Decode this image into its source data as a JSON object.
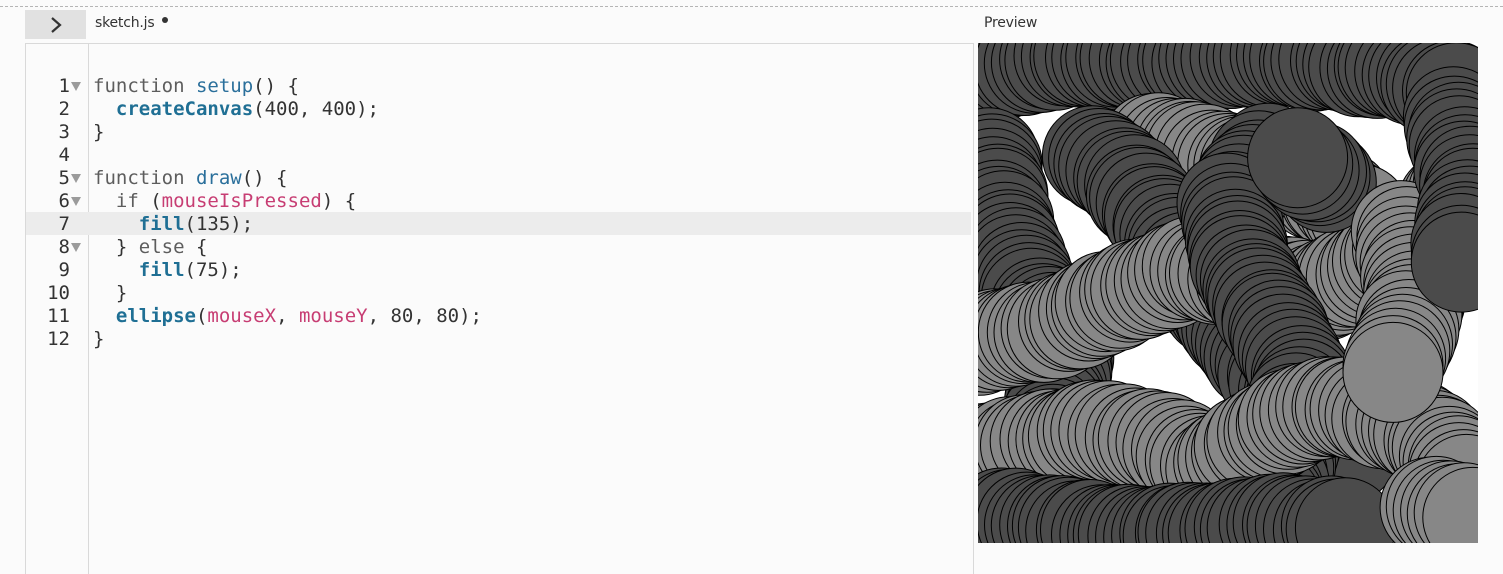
{
  "editor": {
    "toggle_icon": "chevron-right-icon",
    "file_name": "sketch.js",
    "unsaved": true,
    "active_line": 7,
    "lines": [
      {
        "number": "1",
        "fold": true,
        "tokens": [
          {
            "t": "kw",
            "v": "function "
          },
          {
            "t": "fn",
            "v": "setup"
          },
          {
            "t": "plain",
            "v": "() {"
          }
        ]
      },
      {
        "number": "2",
        "fold": false,
        "tokens": [
          {
            "t": "plain",
            "v": "  "
          },
          {
            "t": "builtin",
            "v": "createCanvas"
          },
          {
            "t": "plain",
            "v": "(400, 400);"
          }
        ]
      },
      {
        "number": "3",
        "fold": false,
        "tokens": [
          {
            "t": "plain",
            "v": "}"
          }
        ]
      },
      {
        "number": "4",
        "fold": false,
        "tokens": []
      },
      {
        "number": "5",
        "fold": true,
        "tokens": [
          {
            "t": "kw",
            "v": "function "
          },
          {
            "t": "fn",
            "v": "draw"
          },
          {
            "t": "plain",
            "v": "() {"
          }
        ]
      },
      {
        "number": "6",
        "fold": true,
        "tokens": [
          {
            "t": "plain",
            "v": "  "
          },
          {
            "t": "kw",
            "v": "if"
          },
          {
            "t": "plain",
            "v": " ("
          },
          {
            "t": "var",
            "v": "mouseIsPressed"
          },
          {
            "t": "plain",
            "v": ") {"
          }
        ]
      },
      {
        "number": "7",
        "fold": false,
        "tokens": [
          {
            "t": "plain",
            "v": "    "
          },
          {
            "t": "builtin",
            "v": "fill"
          },
          {
            "t": "plain",
            "v": "(135);"
          }
        ]
      },
      {
        "number": "8",
        "fold": true,
        "tokens": [
          {
            "t": "plain",
            "v": "  } "
          },
          {
            "t": "kw",
            "v": "else"
          },
          {
            "t": "plain",
            "v": " {"
          }
        ]
      },
      {
        "number": "9",
        "fold": false,
        "tokens": [
          {
            "t": "plain",
            "v": "    "
          },
          {
            "t": "builtin",
            "v": "fill"
          },
          {
            "t": "plain",
            "v": "(75);"
          }
        ]
      },
      {
        "number": "10",
        "fold": false,
        "tokens": [
          {
            "t": "plain",
            "v": "  }"
          }
        ]
      },
      {
        "number": "11",
        "fold": false,
        "tokens": [
          {
            "t": "plain",
            "v": "  "
          },
          {
            "t": "builtin",
            "v": "ellipse"
          },
          {
            "t": "plain",
            "v": "("
          },
          {
            "t": "var",
            "v": "mouseX"
          },
          {
            "t": "plain",
            "v": ", "
          },
          {
            "t": "var",
            "v": "mouseY"
          },
          {
            "t": "plain",
            "v": ", 80, 80);"
          }
        ]
      },
      {
        "number": "12",
        "fold": false,
        "tokens": [
          {
            "t": "plain",
            "v": "}"
          }
        ]
      }
    ]
  },
  "preview": {
    "label": "Preview",
    "canvas_background": "#ffffff",
    "fill_pressed": "#878787",
    "fill_released": "#4b4b4b",
    "stroke": "#000000"
  },
  "colors": {
    "keyword": "#5d5d5d",
    "function_name": "#2a6f9b",
    "builtin": "#1f6f94",
    "variable": "#c73d73",
    "text": "#333333"
  }
}
